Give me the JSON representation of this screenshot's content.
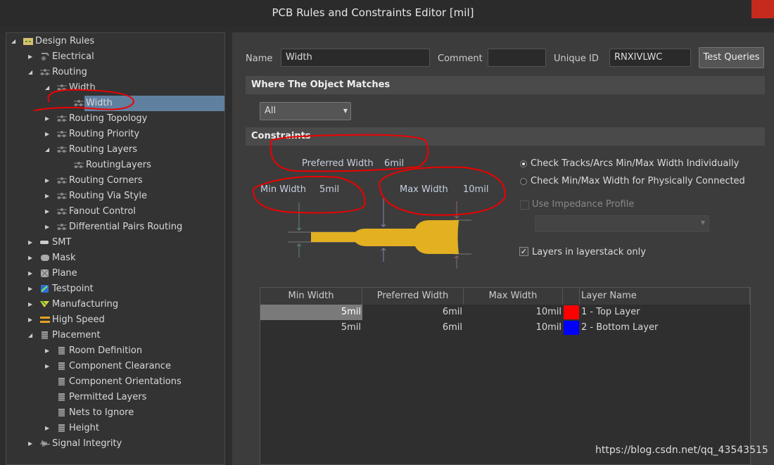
{
  "window": {
    "title": "PCB Rules and Constraints Editor [mil]"
  },
  "tree": [
    {
      "label": "Design Rules",
      "level": 0,
      "arrow": "down",
      "icon": "folder-rules-icon"
    },
    {
      "label": "Electrical",
      "level": 1,
      "arrow": "right",
      "icon": "electrical-icon"
    },
    {
      "label": "Routing",
      "level": 1,
      "arrow": "down",
      "icon": "rule-icon"
    },
    {
      "label": "Width",
      "level": 2,
      "arrow": "down",
      "icon": "rule-icon"
    },
    {
      "label": "Width",
      "level": 3,
      "arrow": "",
      "icon": "rule-icon",
      "selected": true
    },
    {
      "label": "Routing Topology",
      "level": 2,
      "arrow": "right",
      "icon": "rule-icon"
    },
    {
      "label": "Routing Priority",
      "level": 2,
      "arrow": "right",
      "icon": "rule-icon"
    },
    {
      "label": "Routing Layers",
      "level": 2,
      "arrow": "down",
      "icon": "rule-icon"
    },
    {
      "label": "RoutingLayers",
      "level": 3,
      "arrow": "",
      "icon": "rule-icon"
    },
    {
      "label": "Routing Corners",
      "level": 2,
      "arrow": "right",
      "icon": "rule-icon"
    },
    {
      "label": "Routing Via Style",
      "level": 2,
      "arrow": "right",
      "icon": "rule-icon"
    },
    {
      "label": "Fanout Control",
      "level": 2,
      "arrow": "right",
      "icon": "rule-icon"
    },
    {
      "label": "Differential Pairs Routing",
      "level": 2,
      "arrow": "right",
      "icon": "rule-icon"
    },
    {
      "label": "SMT",
      "level": 1,
      "arrow": "right",
      "icon": "smt-icon"
    },
    {
      "label": "Mask",
      "level": 1,
      "arrow": "right",
      "icon": "mask-icon"
    },
    {
      "label": "Plane",
      "level": 1,
      "arrow": "right",
      "icon": "plane-icon"
    },
    {
      "label": "Testpoint",
      "level": 1,
      "arrow": "right",
      "icon": "testpoint-icon"
    },
    {
      "label": "Manufacturing",
      "level": 1,
      "arrow": "right",
      "icon": "manufacturing-icon"
    },
    {
      "label": "High Speed",
      "level": 1,
      "arrow": "right",
      "icon": "high-speed-icon"
    },
    {
      "label": "Placement",
      "level": 1,
      "arrow": "down",
      "icon": "placement-icon"
    },
    {
      "label": "Room Definition",
      "level": 2,
      "arrow": "right",
      "icon": "placement-icon"
    },
    {
      "label": "Component Clearance",
      "level": 2,
      "arrow": "right",
      "icon": "placement-icon"
    },
    {
      "label": "Component Orientations",
      "level": 2,
      "arrow": "",
      "icon": "placement-icon"
    },
    {
      "label": "Permitted Layers",
      "level": 2,
      "arrow": "",
      "icon": "placement-icon"
    },
    {
      "label": "Nets to Ignore",
      "level": 2,
      "arrow": "",
      "icon": "placement-icon"
    },
    {
      "label": "Height",
      "level": 2,
      "arrow": "right",
      "icon": "placement-icon"
    },
    {
      "label": "Signal Integrity",
      "level": 1,
      "arrow": "right",
      "icon": "signal-integrity-icon"
    }
  ],
  "form": {
    "name_label": "Name",
    "name_value": "Width",
    "comment_label": "Comment",
    "comment_value": "",
    "uid_label": "Unique ID",
    "uid_value": "RNXIVLWC",
    "test_queries": "Test Queries"
  },
  "where": {
    "title": "Where The Object Matches",
    "select_value": "All"
  },
  "constraints": {
    "title": "Constraints",
    "preferred_label": "Preferred Width",
    "preferred_value": "6mil",
    "min_label": "Min Width",
    "min_value": "5mil",
    "max_label": "Max Width",
    "max_value": "10mil",
    "radio1": "Check Tracks/Arcs Min/Max Width Individually",
    "radio1_selected": true,
    "radio2": "Check Min/Max Width for Physically Connected",
    "radio2_selected": false,
    "impedance": "Use Impedance Profile",
    "impedance_checked": false,
    "impedance_enabled": false,
    "layerstack": "Layers in layerstack only",
    "layerstack_checked": true,
    "track_color": "#e3b021"
  },
  "table": {
    "headers": [
      "Min Width",
      "Preferred Width",
      "Max Width",
      "",
      "Layer Name"
    ],
    "rows": [
      {
        "min": "5mil",
        "pref": "6mil",
        "max": "10mil",
        "color": "#ff0000",
        "layer": "1 - Top Layer"
      },
      {
        "min": "5mil",
        "pref": "6mil",
        "max": "10mil",
        "color": "#0000ff",
        "layer": "2 - Bottom Layer"
      }
    ]
  },
  "watermark": "https://blog.csdn.net/qq_43543515"
}
